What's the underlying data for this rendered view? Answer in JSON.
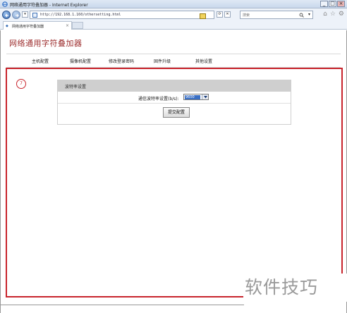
{
  "window": {
    "title": "网络通用字符叠加器 - Internet Explorer",
    "buttons": [
      "_",
      "□",
      "×"
    ]
  },
  "addressbar": {
    "url": "http://192.168.1.160/othersetting.html"
  },
  "search": {
    "placeholder": "搜索"
  },
  "tab": {
    "title": "网络通用字符叠加器",
    "close": "×"
  },
  "page": {
    "brand": "网络通用字符叠加器",
    "menu": [
      {
        "label": "主机配置"
      },
      {
        "label": "摄像机配置"
      },
      {
        "label": "修改登录密码"
      },
      {
        "label": "固件升级"
      },
      {
        "label": "其他设置"
      }
    ],
    "active_menu": "其他设置",
    "marker": "7",
    "panel": {
      "title": "波特率设置",
      "label": "通信波特率设置(b/s):",
      "baud_value": "9600",
      "submit": "提交配置"
    }
  },
  "watermark": "软件技巧",
  "colors": {
    "accent_red": "#c8242c",
    "brand_red": "#9b2a2a",
    "selection_blue": "#3a6fc4"
  }
}
